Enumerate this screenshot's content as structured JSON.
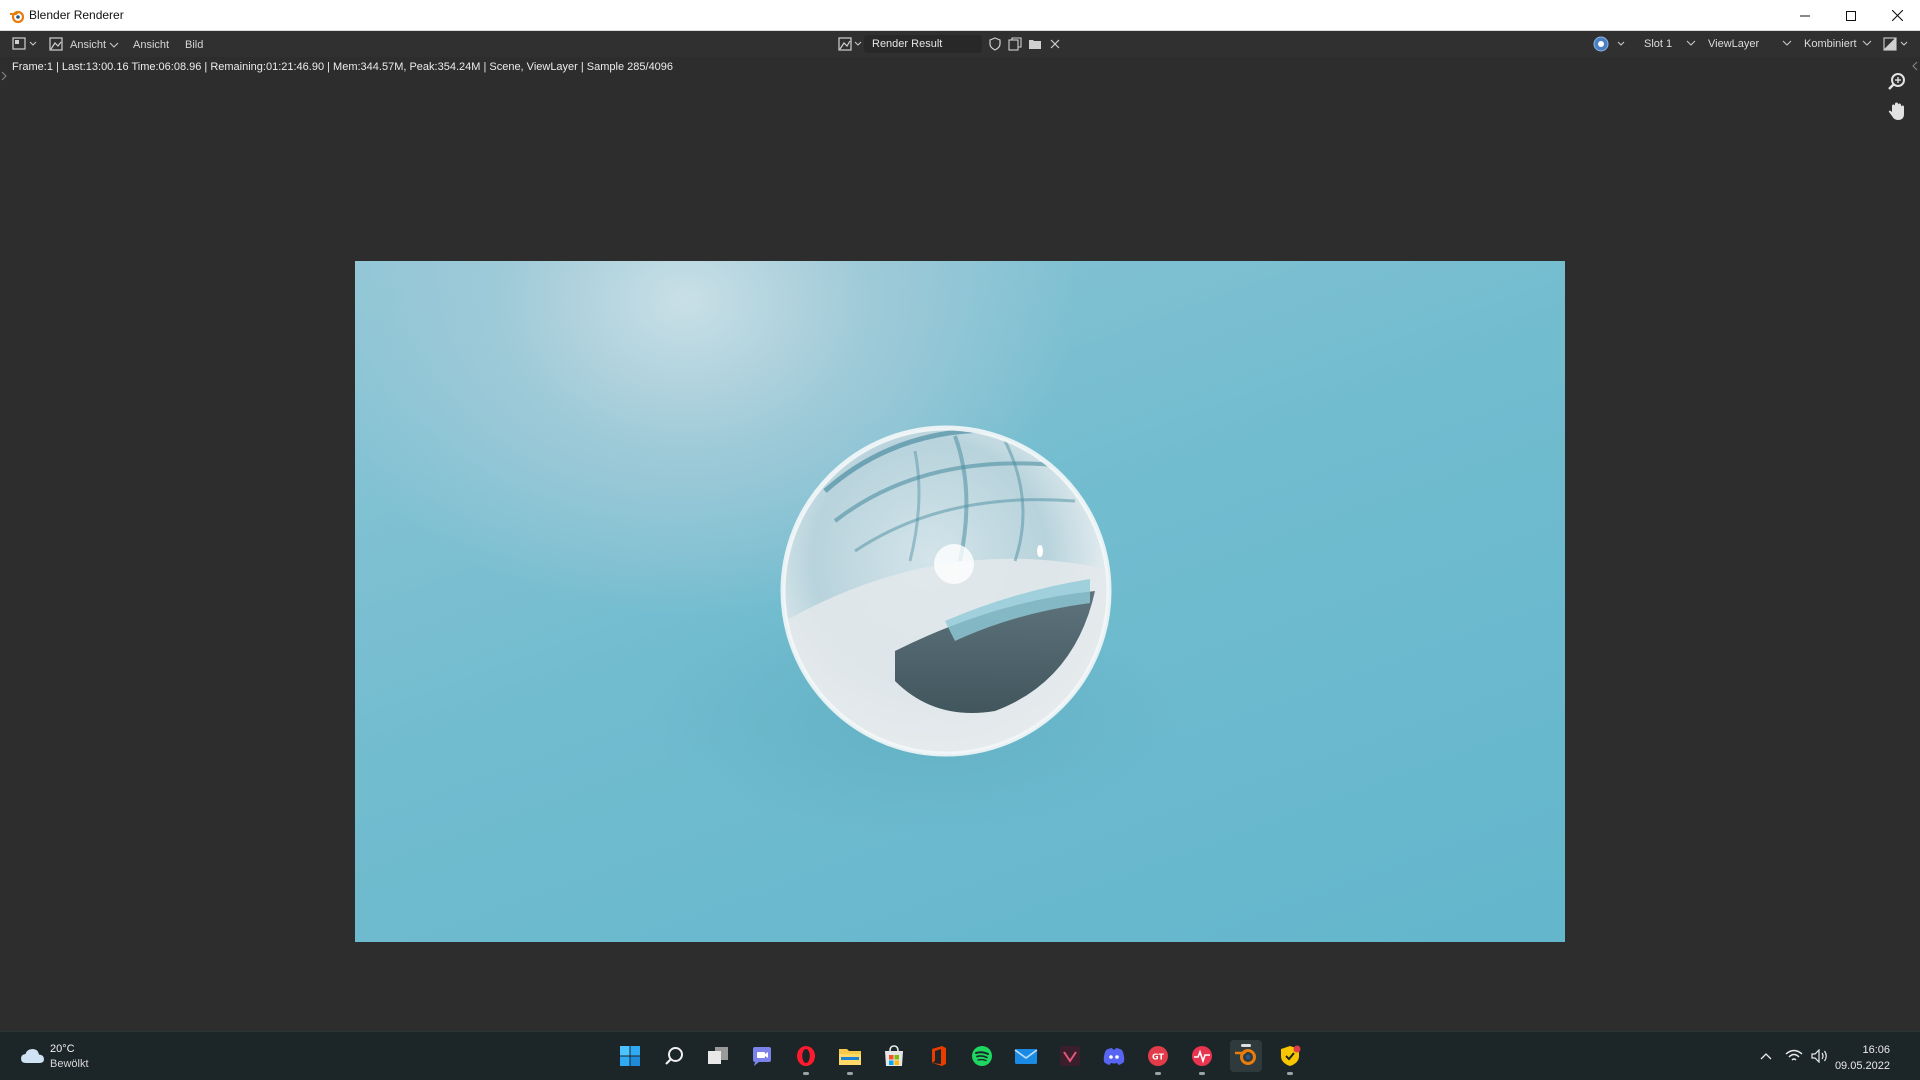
{
  "window": {
    "title": "Blender Renderer"
  },
  "header": {
    "menu_view_1": "Ansicht",
    "menu_view_2": "Ansicht",
    "menu_image": "Bild",
    "image_name": "Render Result",
    "slot": "Slot 1",
    "view_layer": "ViewLayer",
    "pass": "Kombiniert"
  },
  "status": {
    "text": "Frame:1 | Last:13:00.16 Time:06:08.96 | Remaining:01:21:46.90 | Mem:344.57M, Peak:354.24M | Scene, ViewLayer | Sample 285/4096"
  },
  "taskbar": {
    "weather_temp": "20°C",
    "weather_desc": "Bewölkt",
    "time": "16:06",
    "date": "09.05.2022",
    "apps": [
      "windows-start",
      "search",
      "task-view",
      "teams-chat",
      "opera",
      "file-explorer",
      "microsoft-store",
      "office",
      "spotify",
      "mail",
      "affinity",
      "discord",
      "gta",
      "heartbeat-app",
      "blender",
      "norton"
    ]
  },
  "colors": {
    "accent_blender": "#e87d0d",
    "render_bg": "#6cbbd0",
    "taskbar_bg": "#1c2528"
  }
}
